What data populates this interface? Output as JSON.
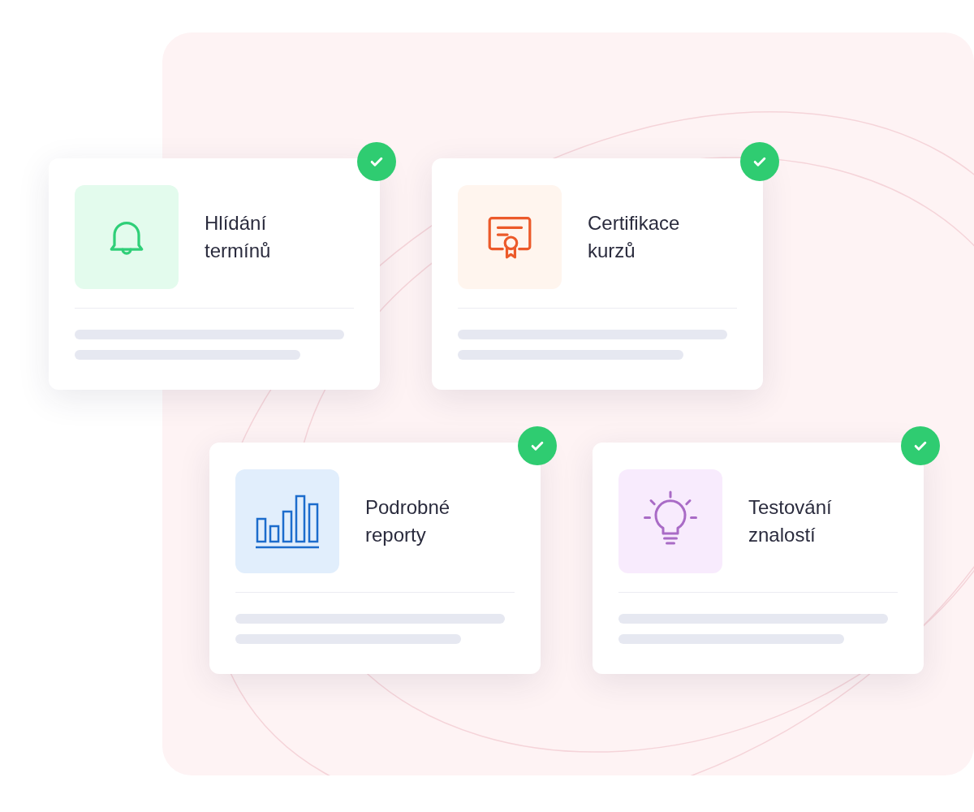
{
  "cards": [
    {
      "kind": "bell",
      "title_lines": [
        "Hlídání",
        "termínů"
      ],
      "checked": true
    },
    {
      "kind": "certificate",
      "title_lines": [
        "Certifikace",
        "kurzů"
      ],
      "checked": true
    },
    {
      "kind": "chart",
      "title_lines": [
        "Podrobné",
        "reporty"
      ],
      "checked": true
    },
    {
      "kind": "bulb",
      "title_lines": [
        "Testování",
        "znalostí"
      ],
      "checked": true
    }
  ]
}
